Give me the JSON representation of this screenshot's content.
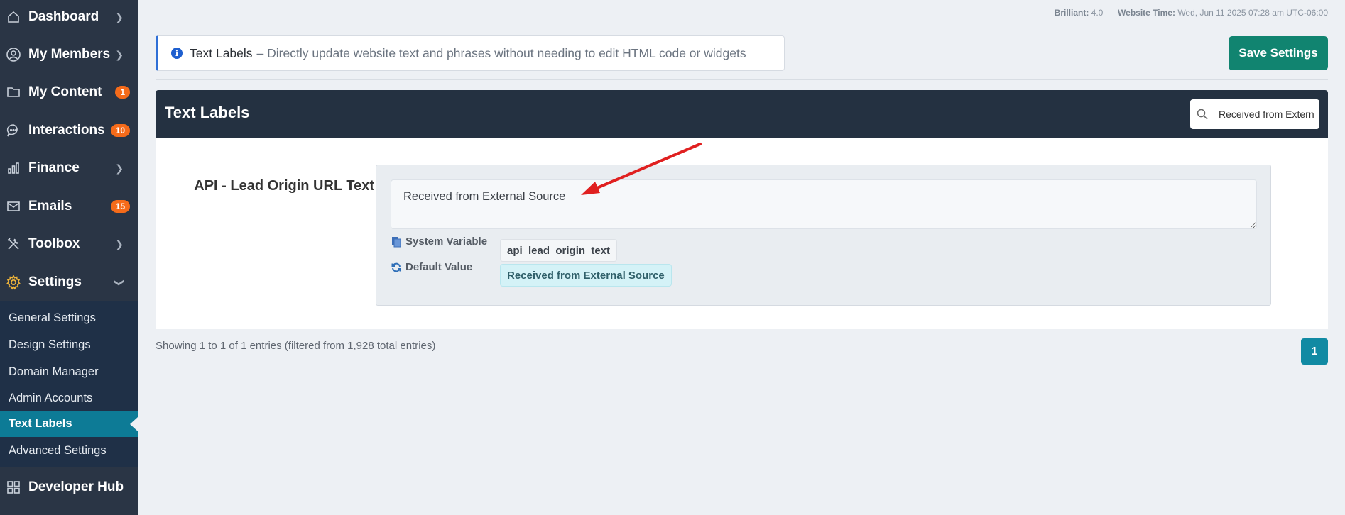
{
  "sidebar": {
    "items": [
      {
        "label": "Dashboard",
        "icon": "home-icon"
      },
      {
        "label": "My Members",
        "icon": "user-icon"
      },
      {
        "label": "My Content",
        "icon": "folder-icon",
        "badge": "1"
      },
      {
        "label": "Interactions",
        "icon": "chat-icon",
        "badge": "10"
      },
      {
        "label": "Finance",
        "icon": "bar-chart-icon"
      },
      {
        "label": "Emails",
        "icon": "mail-icon",
        "badge": "15"
      },
      {
        "label": "Toolbox",
        "icon": "tools-icon"
      },
      {
        "label": "Settings",
        "icon": "gear-icon"
      },
      {
        "label": "Developer Hub",
        "icon": "grid-icon"
      }
    ],
    "settings_submenu": [
      "General Settings",
      "Design Settings",
      "Domain Manager",
      "Admin Accounts",
      "Text Labels",
      "Advanced Settings"
    ],
    "active_submenu": "Text Labels"
  },
  "topinfo": {
    "version_label": "Brilliant:",
    "version_value": "4.0",
    "time_label": "Website Time:",
    "time_value": "Wed, Jun 11 2025 07:28 am UTC-06:00"
  },
  "notice": {
    "title": "Text Labels",
    "description": "– Directly update website text and phrases without needing to edit HTML code or widgets"
  },
  "save_button": "Save Settings",
  "panel": {
    "title": "Text Labels",
    "search_value": "Received from External Source"
  },
  "field": {
    "label": "API - Lead Origin URL Text",
    "value": "Received from External Source",
    "system_variable_label": "System Variable",
    "system_variable_value": "api_lead_origin_text",
    "default_value_label": "Default Value",
    "default_value_value": "Received from External Source"
  },
  "footer": {
    "entries_text": "Showing 1 to 1 of 1 entries (filtered from 1,928 total entries)",
    "page": "1"
  },
  "colors": {
    "sidebar_bg": "#2a3545",
    "submenu_bg": "#1f3047",
    "active_item": "#0d7b96",
    "save_button": "#118470",
    "badge": "#f56b1a",
    "panel_header": "#243141",
    "annotation_arrow": "#e02020"
  }
}
